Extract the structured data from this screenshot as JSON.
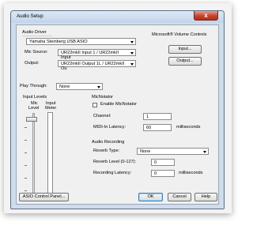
{
  "window": {
    "title": "Audio Setup",
    "close_label": "x"
  },
  "audio_driver": {
    "heading": "Audio Driver",
    "driver_value": "Yamaha Steinberg USB ASIO",
    "mic_source_label": "Mic Source:",
    "mic_source_value": "UR22mkII Input 1 / UR22mkII Input",
    "output_label": "Output:",
    "output_value": "UR22mkII Output 1L / UR22mkII Ou"
  },
  "ms_volume": {
    "heading": "Microsoft® Volume Controls",
    "input_label": "Input...",
    "output_label": "Output..."
  },
  "play_through": {
    "label": "Play Through:",
    "value": "None"
  },
  "input_levels": {
    "heading": "Input Levels",
    "mic_level_label_1": "Mic",
    "mic_level_label_2": "Level",
    "input_meter_label_1": "Input",
    "input_meter_label_2": "Meter"
  },
  "micnotator": {
    "heading": "MicNotator",
    "enable_label": "Enable MicNotator",
    "enable_checked": false,
    "channel_label": "Channel:",
    "channel_value": "1",
    "midi_latency_label": "MIDI-In Latency:",
    "midi_latency_value": "60",
    "midi_latency_unit": "milliseconds"
  },
  "audio_recording": {
    "heading": "Audio Recording",
    "reverb_type_label": "Reverb Type:",
    "reverb_type_value": "None",
    "reverb_level_label": "Reverb Level (0-127):",
    "reverb_level_value": "0",
    "recording_latency_label": "Recording Latency:",
    "recording_latency_value": "0",
    "recording_latency_unit": "milliseconds"
  },
  "buttons": {
    "asio_label": "ASIO Control Panel...",
    "ok_label": "OK",
    "cancel_label": "Cancel",
    "help_label": "Help"
  },
  "colors": {
    "titlebar": "#c2d4ea",
    "close": "#c7432d",
    "dialog_bg": "#f0f0f0",
    "focus": "#3c7fb1"
  }
}
